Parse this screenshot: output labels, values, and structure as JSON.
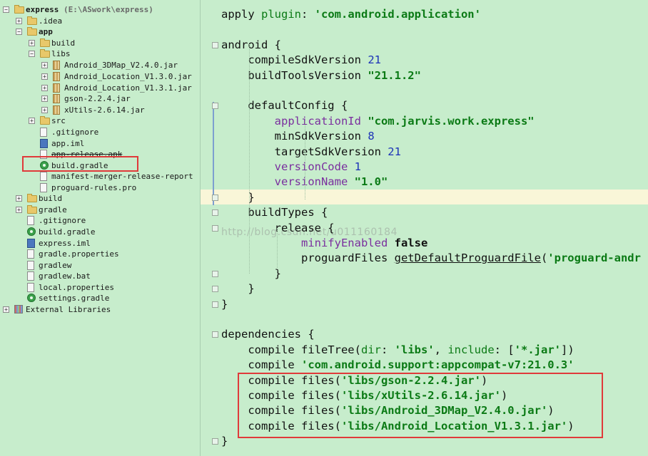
{
  "tree": {
    "items": [
      {
        "label": "express",
        "suffix": " (E:\\ASwork\\express)",
        "kind": "folder",
        "depth": 0,
        "expanded": true,
        "bold": true
      },
      {
        "label": ".idea",
        "kind": "folder",
        "depth": 1,
        "expanded": false
      },
      {
        "label": "app",
        "kind": "folder",
        "depth": 1,
        "expanded": true,
        "bold": true
      },
      {
        "label": "build",
        "kind": "folder",
        "depth": 2,
        "expanded": false
      },
      {
        "label": "libs",
        "kind": "folder",
        "depth": 2,
        "expanded": true
      },
      {
        "label": "Android_3DMap_V2.4.0.jar",
        "kind": "jar",
        "depth": 3,
        "expanded": false
      },
      {
        "label": "Android_Location_V1.3.0.jar",
        "kind": "jar",
        "depth": 3,
        "expanded": false
      },
      {
        "label": "Android_Location_V1.3.1.jar",
        "kind": "jar",
        "depth": 3,
        "expanded": false
      },
      {
        "label": "gson-2.2.4.jar",
        "kind": "jar",
        "depth": 3,
        "expanded": false
      },
      {
        "label": "xUtils-2.6.14.jar",
        "kind": "jar",
        "depth": 3,
        "expanded": false
      },
      {
        "label": "src",
        "kind": "folder",
        "depth": 2,
        "expanded": false
      },
      {
        "label": ".gitignore",
        "kind": "file",
        "depth": 2
      },
      {
        "label": "app.iml",
        "kind": "iml",
        "depth": 2
      },
      {
        "label": "app-release.apk",
        "kind": "file",
        "depth": 2,
        "strike": true
      },
      {
        "label": "build.gradle",
        "kind": "gradle",
        "depth": 2,
        "selected": true
      },
      {
        "label": "manifest-merger-release-report",
        "kind": "file",
        "depth": 2
      },
      {
        "label": "proguard-rules.pro",
        "kind": "file",
        "depth": 2
      },
      {
        "label": "build",
        "kind": "folder",
        "depth": 1,
        "expanded": false
      },
      {
        "label": "gradle",
        "kind": "folder",
        "depth": 1,
        "expanded": false
      },
      {
        "label": ".gitignore",
        "kind": "file",
        "depth": 1
      },
      {
        "label": "build.gradle",
        "kind": "gradle",
        "depth": 1
      },
      {
        "label": "express.iml",
        "kind": "iml",
        "depth": 1
      },
      {
        "label": "gradle.properties",
        "kind": "file",
        "depth": 1
      },
      {
        "label": "gradlew",
        "kind": "file",
        "depth": 1
      },
      {
        "label": "gradlew.bat",
        "kind": "file",
        "depth": 1
      },
      {
        "label": "local.properties",
        "kind": "file",
        "depth": 1
      },
      {
        "label": "settings.gradle",
        "kind": "gradle",
        "depth": 1
      },
      {
        "label": "External Libraries",
        "kind": "lib",
        "depth": 0,
        "expanded": false
      }
    ]
  },
  "editor": {
    "lines": [
      [
        {
          "t": "apply ",
          "c": "plain"
        },
        {
          "t": "plugin",
          "c": "str-plain"
        },
        {
          "t": ": ",
          "c": "plain"
        },
        {
          "t": "'com.android.application'",
          "c": "str"
        }
      ],
      [],
      [
        {
          "t": "android {",
          "c": "plain"
        }
      ],
      [
        {
          "t": "    compileSdkVersion ",
          "c": "plain"
        },
        {
          "t": "21",
          "c": "num"
        }
      ],
      [
        {
          "t": "    buildToolsVersion ",
          "c": "plain"
        },
        {
          "t": "\"21.1.2\"",
          "c": "str"
        }
      ],
      [],
      [
        {
          "t": "    defaultConfig ",
          "c": "plain"
        },
        {
          "t": "{",
          "c": "plain"
        }
      ],
      [
        {
          "t": "        applicationId ",
          "c": "prop"
        },
        {
          "t": "\"com.jarvis.work.express\"",
          "c": "str"
        }
      ],
      [
        {
          "t": "        minSdkVersion ",
          "c": "plain"
        },
        {
          "t": "8",
          "c": "num"
        }
      ],
      [
        {
          "t": "        targetSdkVersion ",
          "c": "plain"
        },
        {
          "t": "21",
          "c": "num"
        }
      ],
      [
        {
          "t": "        versionCode ",
          "c": "prop"
        },
        {
          "t": "1",
          "c": "num"
        }
      ],
      [
        {
          "t": "        versionName ",
          "c": "prop"
        },
        {
          "t": "\"1.0\"",
          "c": "str"
        }
      ],
      [
        {
          "t": "    }",
          "c": "plain"
        }
      ],
      [
        {
          "t": "    buildTypes {",
          "c": "plain"
        }
      ],
      [
        {
          "t": "        release {",
          "c": "plain"
        }
      ],
      [
        {
          "t": "            minifyEnabled ",
          "c": "prop"
        },
        {
          "t": "false",
          "c": "kw"
        }
      ],
      [
        {
          "t": "            proguardFiles ",
          "c": "plain"
        },
        {
          "t": "getDefaultProguardFile",
          "c": "fn"
        },
        {
          "t": "(",
          "c": "plain"
        },
        {
          "t": "'proguard-andr",
          "c": "str"
        }
      ],
      [
        {
          "t": "        }",
          "c": "plain"
        }
      ],
      [
        {
          "t": "    }",
          "c": "plain"
        }
      ],
      [
        {
          "t": "}",
          "c": "plain"
        }
      ],
      [],
      [
        {
          "t": "dependencies {",
          "c": "plain"
        }
      ],
      [
        {
          "t": "    compile ",
          "c": "plain"
        },
        {
          "t": "fileTree(",
          "c": "plain"
        },
        {
          "t": "dir",
          "c": "str-plain"
        },
        {
          "t": ": ",
          "c": "plain"
        },
        {
          "t": "'libs'",
          "c": "str"
        },
        {
          "t": ", ",
          "c": "plain"
        },
        {
          "t": "include",
          "c": "str-plain"
        },
        {
          "t": ": [",
          "c": "plain"
        },
        {
          "t": "'*.jar'",
          "c": "str"
        },
        {
          "t": "])",
          "c": "plain"
        }
      ],
      [
        {
          "t": "    compile ",
          "c": "plain"
        },
        {
          "t": "'com.android.support:appcompat-v7:21.0.3'",
          "c": "str"
        }
      ],
      [
        {
          "t": "    compile files(",
          "c": "plain"
        },
        {
          "t": "'libs/gson-2.2.4.jar'",
          "c": "str"
        },
        {
          "t": ")",
          "c": "plain"
        }
      ],
      [
        {
          "t": "    compile files(",
          "c": "plain"
        },
        {
          "t": "'libs/xUtils-2.6.14.jar'",
          "c": "str"
        },
        {
          "t": ")",
          "c": "plain"
        }
      ],
      [
        {
          "t": "    compile files(",
          "c": "plain"
        },
        {
          "t": "'libs/Android_3DMap_V2.4.0.jar'",
          "c": "str"
        },
        {
          "t": ")",
          "c": "plain"
        }
      ],
      [
        {
          "t": "    compile files(",
          "c": "plain"
        },
        {
          "t": "'libs/Android_Location_V1.3.1.jar'",
          "c": "str"
        },
        {
          "t": ")",
          "c": "plain"
        }
      ],
      [
        {
          "t": "}",
          "c": "plain"
        }
      ]
    ],
    "watermark": "http://blog.csdn.net/u011160184"
  },
  "colors": {
    "background": "#c7edcc",
    "highlight": "#e03a3a",
    "string": "#0b7a15",
    "number": "#1c33b8",
    "property": "#7a2f9e"
  }
}
